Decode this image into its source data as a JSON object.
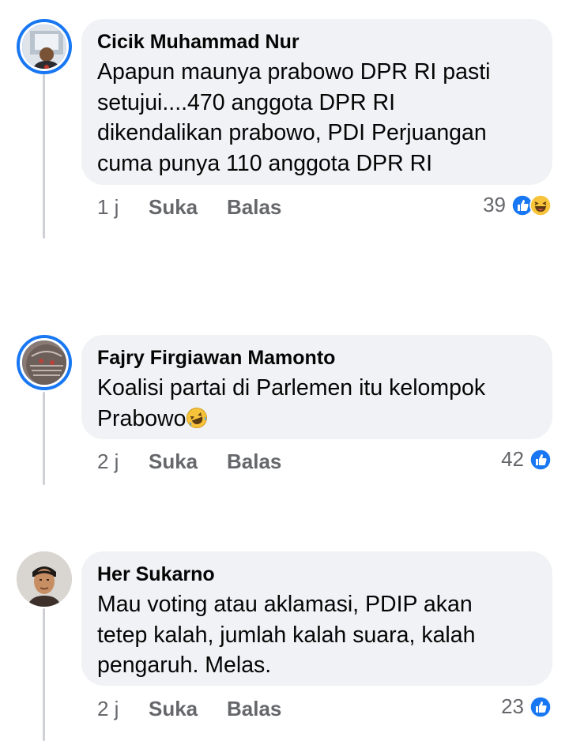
{
  "comments": [
    {
      "author": "Cicik Muhammad Nur",
      "text": "Apapun maunya prabowo DPR RI pasti\nsetujui....470 anggota DPR RI\ndikendalikan prabowo, PDI Perjuangan\ncuma punya 110 anggota DPR RI",
      "time": "1 j",
      "like_label": "Suka",
      "reply_label": "Balas",
      "reaction_count": "39",
      "reactions": [
        "like-icon",
        "haha-icon"
      ],
      "colors": {
        "avatar_ring": "#1877f2"
      }
    },
    {
      "author": "Fajry Firgiawan Mamonto",
      "text": "Koalisi partai di Parlemen itu kelompok\nPrabowo",
      "text_emoji": "rolling-laughing-emoji",
      "time": "2 j",
      "like_label": "Suka",
      "reply_label": "Balas",
      "reaction_count": "42",
      "reactions": [
        "like-icon"
      ],
      "colors": {
        "avatar_ring": "#1877f2"
      }
    },
    {
      "author": "Her Sukarno",
      "text": "Mau voting atau aklamasi, PDIP akan\ntetep kalah, jumlah kalah suara, kalah\npengaruh. Melas.",
      "time": "2 j",
      "like_label": "Suka",
      "reply_label": "Balas",
      "reaction_count": "23",
      "reactions": [
        "like-icon"
      ]
    }
  ],
  "colors": {
    "bubble": "#f0f2f5",
    "meta_text": "#65676b",
    "like_blue": "#1877f2",
    "haha_yellow": "#f7c33a"
  }
}
